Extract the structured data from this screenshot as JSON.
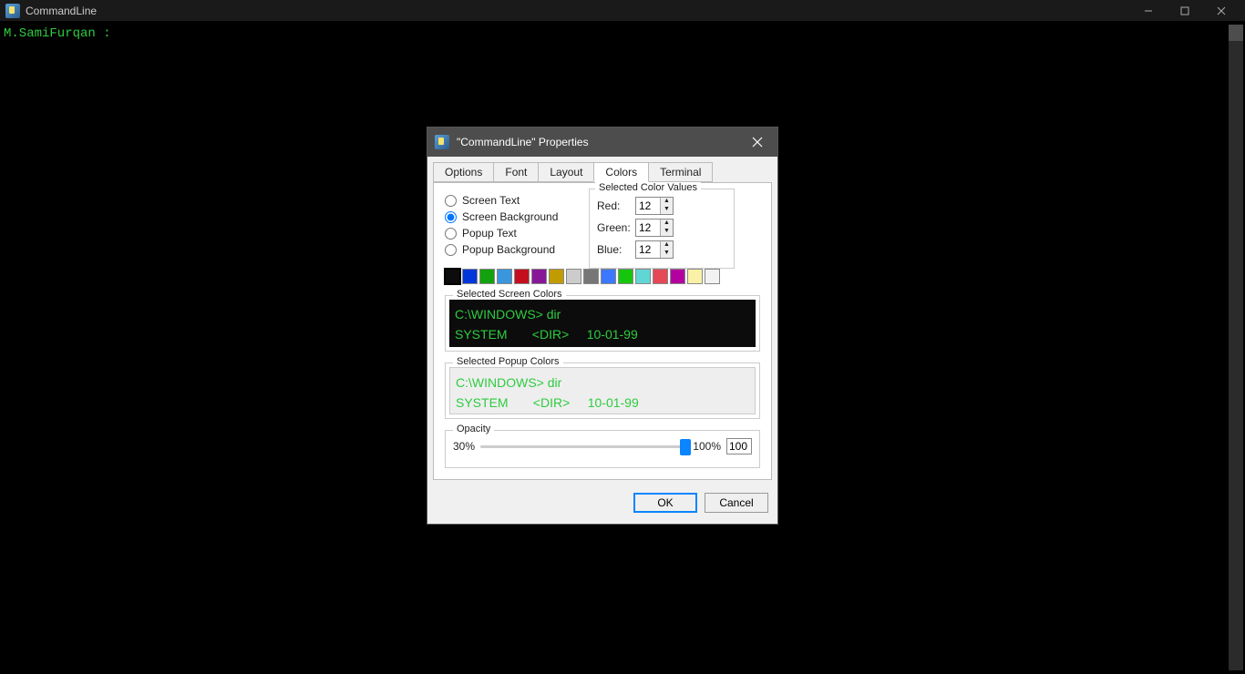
{
  "window": {
    "title": "CommandLine"
  },
  "terminal": {
    "prompt": "M.SamiFurqan :"
  },
  "dialog": {
    "title": "\"CommandLine\" Properties",
    "tabs": {
      "options": "Options",
      "font": "Font",
      "layout": "Layout",
      "colors": "Colors",
      "terminal": "Terminal"
    },
    "radios": {
      "screen_text": "Screen Text",
      "screen_background": "Screen Background",
      "popup_text": "Popup Text",
      "popup_background": "Popup Background"
    },
    "color_values": {
      "legend": "Selected Color Values",
      "red_label": "Red:",
      "red": "12",
      "green_label": "Green:",
      "green": "12",
      "blue_label": "Blue:",
      "blue": "12"
    },
    "palette": [
      "#0c0c0c",
      "#0037da",
      "#13a10e",
      "#3a96dd",
      "#c50f1f",
      "#881798",
      "#c19c00",
      "#cccccc",
      "#767676",
      "#3b78ff",
      "#16c60c",
      "#61d6d6",
      "#e74856",
      "#b4009e",
      "#f9f1a5",
      "#f2f2f2"
    ],
    "screen_preview": {
      "legend": "Selected Screen Colors",
      "line1": "C:\\WINDOWS> dir",
      "line2": "SYSTEM       <DIR>     10-01-99"
    },
    "popup_preview": {
      "legend": "Selected Popup Colors",
      "line1": "C:\\WINDOWS> dir",
      "line2": "SYSTEM       <DIR>     10-01-99"
    },
    "opacity": {
      "legend": "Opacity",
      "min_label": "30%",
      "max_label": "100%",
      "value": "100"
    },
    "buttons": {
      "ok": "OK",
      "cancel": "Cancel"
    }
  }
}
